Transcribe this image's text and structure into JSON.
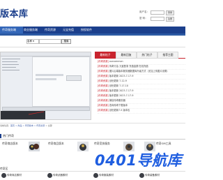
{
  "header": {
    "site_title": "版本库",
    "login": {
      "user_label": "用户名：",
      "pass_label": "密  码：",
      "login_button": "登录",
      "register_button": "注册"
    }
  },
  "nav": {
    "items": [
      "传奇服务端",
      "商业服务端",
      "传奇资源",
      "元宝充值",
      "授权软件"
    ]
  },
  "search": {
    "select_value": "名称",
    "button": "搜索"
  },
  "news_panel": {
    "tabs": [
      "最新帖子",
      "最新回复",
      "热门帖子",
      "推荐主题"
    ],
    "items": [
      {
        "tag": "[传奇资源]",
        "text": "ourcommon"
      },
      {
        "tag": "[传奇资源]",
        "text": "传奇行会 元宝登录 充值金额 在线充值"
      },
      {
        "tag": "[传奇资源]",
        "text": "图片后端版本服务器数据库升级方式（无加上传图片设置）"
      },
      {
        "tag": "[传奇资源]",
        "text": "版本更新 2023-7-17-9"
      },
      {
        "tag": "[传奇资源]",
        "text": "创世更新 7-12-9"
      },
      {
        "tag": "[传奇资源]",
        "text": "创世更新 7-17-10"
      },
      {
        "tag": "[传奇资源]",
        "text": "版本更新 2023-7-17-9"
      },
      {
        "tag": "[传奇资源]",
        "text": "版本更新 2023-7-17-9"
      },
      {
        "tag": "[传奇资源]",
        "text": "微信传奇服务器"
      },
      {
        "tag": "[传奇资源]",
        "text": "查询传奇下载版本"
      },
      {
        "tag": "[传奇资源]",
        "text": "创世更新7-5 版本包"
      }
    ]
  },
  "breadcrumb": {
    "prefix": "当前位置：",
    "trail": "首页 > 商品 > 传奇版本 > 传奇资源",
    "last": "全部"
  },
  "section1": {
    "title": "热门传奇",
    "products": [
      "传奇商店版本",
      "传奇商品版本",
      "传奇竞技服务",
      "传奇GM工具"
    ]
  },
  "section2": {
    "title": "传奇区",
    "products": [
      "传奇商店素材",
      "传奇武器素材",
      "传奇服装素材",
      "传奇装备素材"
    ]
  },
  "watermark": "0401导航库",
  "colors": {
    "nav_blue": "#1b3f8c",
    "accent_red": "#c9242e",
    "watermark_blue": "#1f5ee0"
  }
}
